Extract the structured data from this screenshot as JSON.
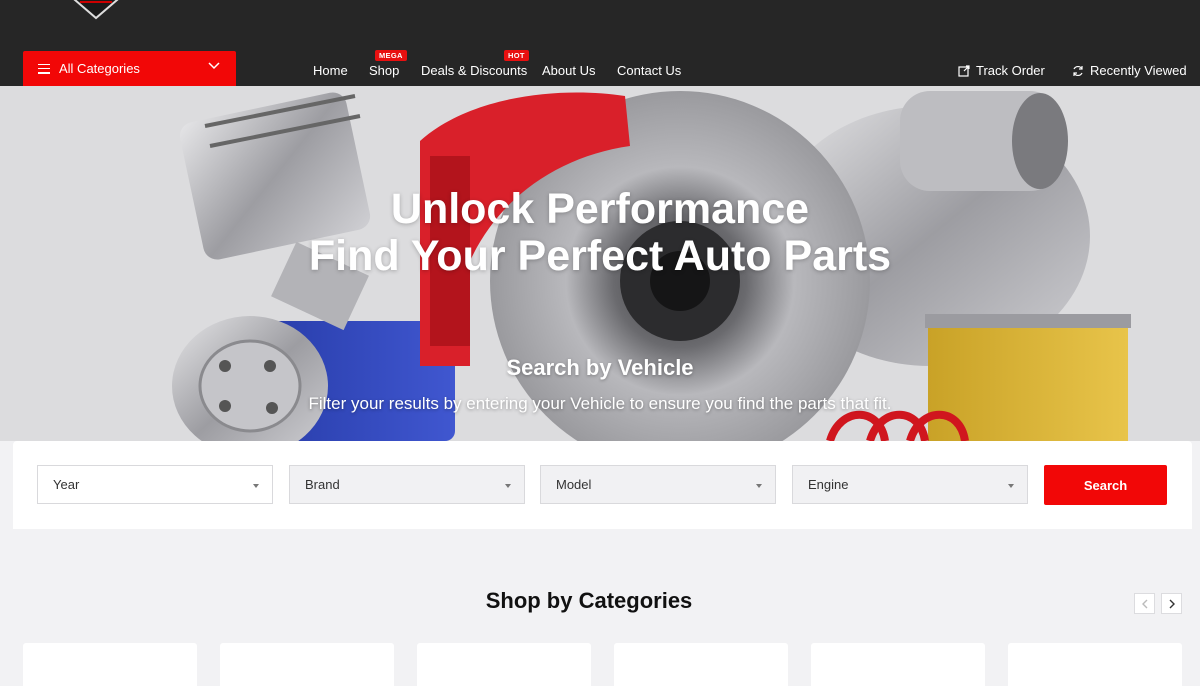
{
  "header": {
    "all_categories_label": "All Categories",
    "nav": [
      {
        "label": "Home",
        "badge": ""
      },
      {
        "label": "Shop",
        "badge": "MEGA"
      },
      {
        "label": "Deals & Discounts",
        "badge": "HOT"
      },
      {
        "label": "About Us",
        "badge": ""
      },
      {
        "label": "Contact Us",
        "badge": ""
      }
    ],
    "track_order_label": "Track Order",
    "recently_viewed_label": "Recently Viewed",
    "icons": {
      "menu": "hamburger-icon",
      "dropdown": "chevron-down-icon",
      "track": "external-link-icon",
      "recent": "refresh-icon"
    }
  },
  "hero": {
    "title_line1": "Unlock Performance",
    "title_line2": "Find Your Perfect Auto Parts",
    "subtitle": "Search by Vehicle",
    "description": "Filter your results by entering your Vehicle to ensure you find the parts that fit."
  },
  "vehicle_search": {
    "year": "Year",
    "brand": "Brand",
    "model": "Model",
    "engine": "Engine",
    "search_label": "Search"
  },
  "categories": {
    "title": "Shop by Categories",
    "icons": {
      "prev": "chevron-left-icon",
      "next": "chevron-right-icon"
    }
  },
  "colors": {
    "accent": "#f20707",
    "topbar": "#262626",
    "page_bg": "#f2f2f4"
  }
}
